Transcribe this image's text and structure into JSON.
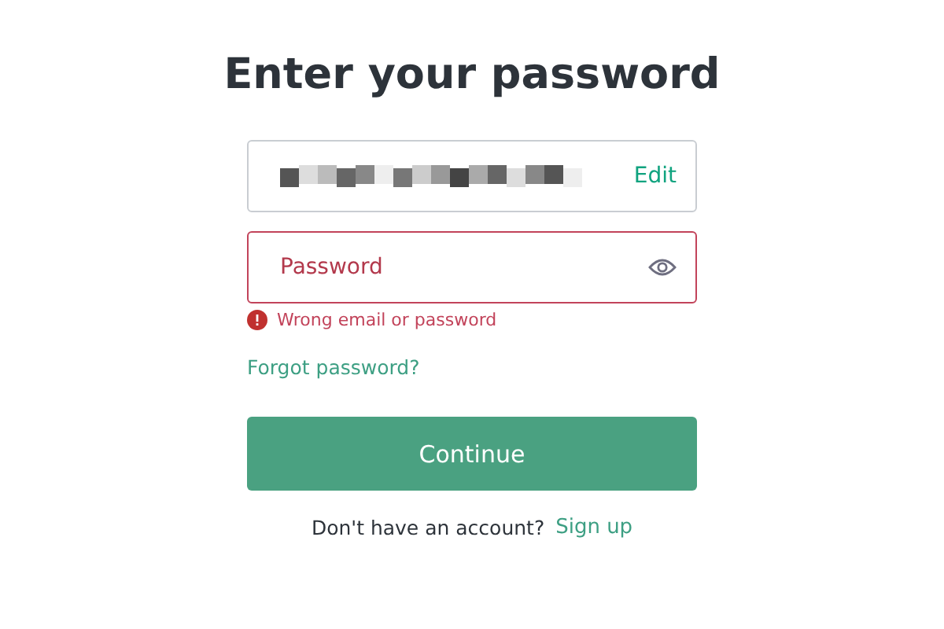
{
  "title": "Enter your password",
  "email_field": {
    "redacted": true,
    "action": "Edit"
  },
  "password_field": {
    "placeholder": "Password",
    "invalid": true
  },
  "error": "Wrong email or password",
  "forgot_link": "Forgot password?",
  "continue_button": "Continue",
  "signup": {
    "prompt": "Don't have an account?",
    "link": "Sign up"
  }
}
